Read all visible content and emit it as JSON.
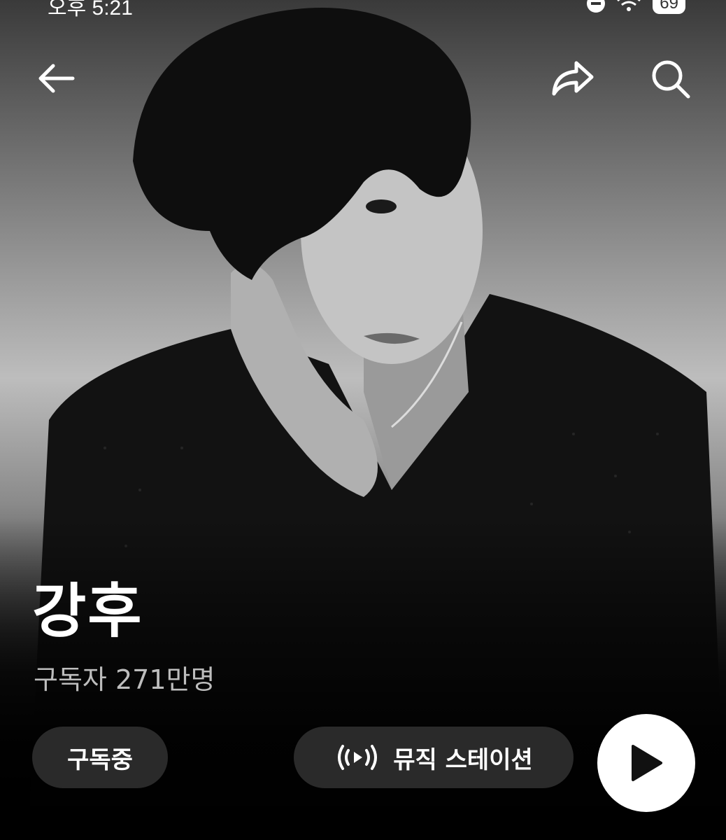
{
  "status_bar": {
    "time": "오후 5:21",
    "battery": "69"
  },
  "top_bar": {
    "back_icon": "arrow-left-icon",
    "share_icon": "share-icon",
    "search_icon": "search-icon"
  },
  "artist": {
    "name": "강후",
    "subscribers": "구독자 271만명"
  },
  "actions": {
    "subscribe_label": "구독중",
    "station_label": "뮤직 스테이션",
    "station_icon": "radio-broadcast-icon",
    "play_icon": "play-icon"
  },
  "colors": {
    "button_bg": "#2a2a2a",
    "play_bg": "#ffffff",
    "text_primary": "#ffffff",
    "text_secondary": "#bdbdbd"
  }
}
